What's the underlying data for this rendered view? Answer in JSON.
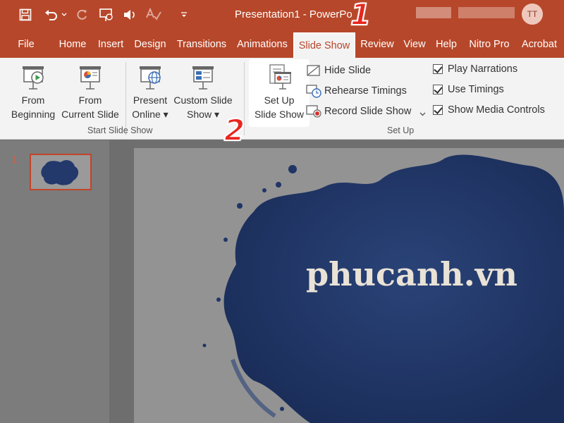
{
  "title_bar": {
    "title": "Presentation1  -  PowerPo",
    "avatar_initials": "TT",
    "quick_access": [
      "save-icon",
      "undo-icon",
      "redo-icon",
      "present-icon",
      "speaker-icon",
      "spelling-icon",
      "customize-icon"
    ]
  },
  "tabs": [
    "File",
    "Home",
    "Insert",
    "Design",
    "Transitions",
    "Animations",
    "Slide Show",
    "Review",
    "View",
    "Help",
    "Nitro Pro",
    "Acrobat"
  ],
  "active_tab": "Slide Show",
  "ribbon": {
    "start_group": {
      "label": "Start Slide Show",
      "from_beginning": [
        "From",
        "Beginning"
      ],
      "from_current": [
        "From",
        "Current Slide"
      ],
      "present_online": [
        "Present",
        "Online ▾"
      ],
      "custom_show": [
        "Custom Slide",
        "Show ▾"
      ]
    },
    "setup_group": {
      "label": "Set Up",
      "setup_show": [
        "Set Up",
        "Slide Show"
      ],
      "hide_slide": "Hide Slide",
      "rehearse": "Rehearse Timings",
      "record": "Record Slide Show",
      "play_narrations": "Play Narrations",
      "use_timings": "Use Timings",
      "show_media": "Show Media Controls"
    }
  },
  "slides": {
    "number": "1"
  },
  "slide": {
    "text": "phucanh.vn"
  },
  "annotations": {
    "step1": "1",
    "step2": "2"
  },
  "colors": {
    "accent": "#b7472a",
    "ink": "#1f3566",
    "marker": "#e8261e"
  }
}
